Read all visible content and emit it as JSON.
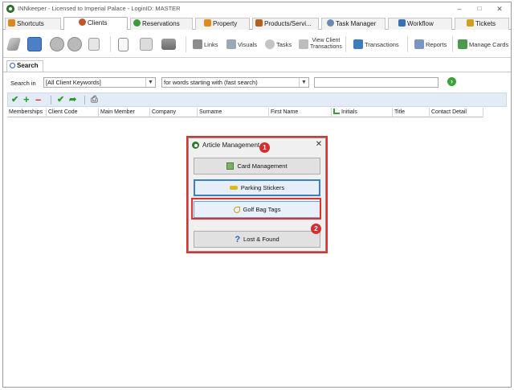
{
  "window": {
    "title": "INNkeeper - Licensed to Imperial Palace - LoginID: MASTER",
    "minimize_glyph": "–",
    "maximize_glyph": "□",
    "close_glyph": "✕"
  },
  "tabs": [
    {
      "label": "Shortcuts",
      "icon": "shortcuts-icon",
      "color": "#d98a1e"
    },
    {
      "label": "Clients",
      "icon": "clients-icon",
      "color": "#c0562a",
      "active": true
    },
    {
      "label": "Reservations",
      "icon": "reservations-icon",
      "color": "#3c9a3c"
    },
    {
      "label": "Property",
      "icon": "property-icon",
      "color": "#e08a1e"
    },
    {
      "label": "Products/Servi...",
      "icon": "products-icon",
      "color": "#b8611f"
    },
    {
      "label": "Task Manager",
      "icon": "task-manager-icon",
      "color": "#6a88b3"
    },
    {
      "label": "Workflow",
      "icon": "workflow-icon",
      "color": "#3a6fb5"
    },
    {
      "label": "Tickets",
      "icon": "tickets-icon",
      "color": "#d0a020"
    }
  ],
  "toolbar": {
    "links_label": "Links",
    "visuals_label": "Visuals",
    "tasks_label": "Tasks",
    "view_client_line1": "View Client",
    "view_client_line2": "Transactions",
    "transactions_label": "Transactions",
    "reports_label": "Reports",
    "manage_cards_label": "Manage Cards"
  },
  "search": {
    "tab_label": "Search",
    "search_in_label": "Search in",
    "scope_value": "[All Client Keywords]",
    "mode_value": "for words starting with (fast search)",
    "query_value": ""
  },
  "columns": [
    "Memberships",
    "Client Code",
    "Main Member",
    "Company",
    "Surname",
    "First Name",
    "Initials",
    "Title",
    "Contact Detail"
  ],
  "dialog": {
    "title": "Article Management",
    "close_glyph": "✕",
    "buttons": {
      "card_management": "Card Management",
      "parking_stickers": "Parking Stickers",
      "golf_bag_tags": "Golf Bag Tags",
      "lost_found": "Lost & Found"
    }
  },
  "annotations": {
    "badge_1": "1",
    "badge_2": "2",
    "annotation_color": "#e03131"
  },
  "colors": {
    "accent_blue": "#3b7ec6",
    "action_bar_bg": "#e3ebf7",
    "green": "#37a437"
  }
}
